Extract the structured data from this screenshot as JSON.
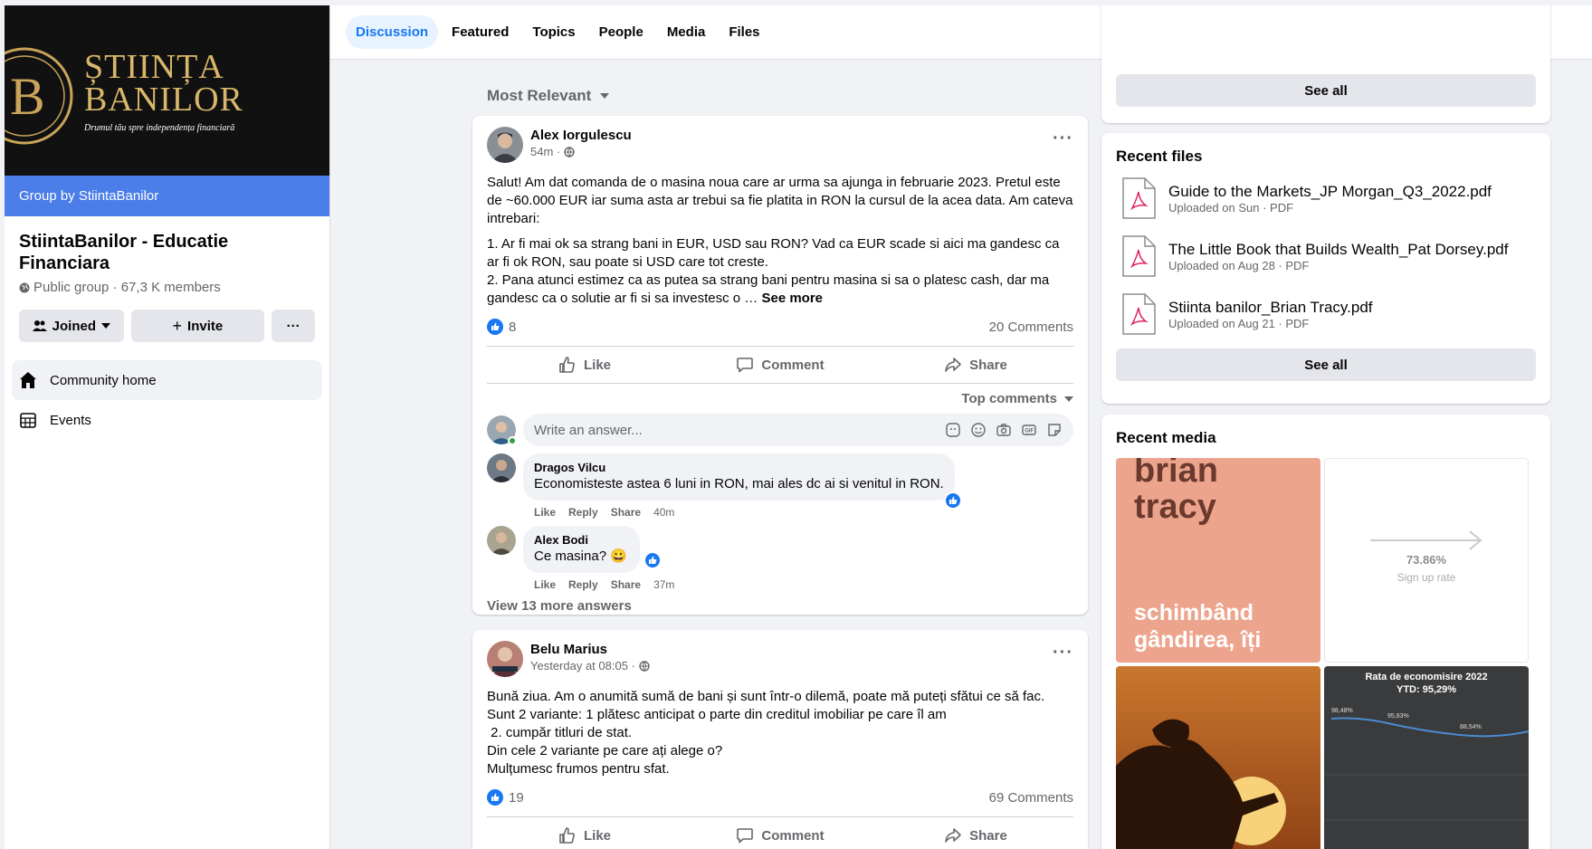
{
  "group": {
    "banner_title_1": "ȘTIINȚA",
    "banner_title_2": "BANILOR",
    "banner_tagline": "Drumul tău spre independența financiară",
    "group_by": "Group by StiintaBanilor",
    "name": "StiintaBanilor - Educatie Financiara",
    "meta": "Public group · 67,3 K members",
    "joined_label": "Joined",
    "invite_label": "Invite",
    "more_label": "···"
  },
  "nav": {
    "community_home": "Community home",
    "events": "Events"
  },
  "tabs": [
    "Discussion",
    "Featured",
    "Topics",
    "People",
    "Media",
    "Files"
  ],
  "feed": {
    "sort_label": "Most Relevant"
  },
  "posts": [
    {
      "author": "Alex Iorgulescu",
      "time": "54m ·",
      "paragraphs": [
        "Salut! Am dat comanda de o masina noua care ar urma sa ajunga in februarie 2023. Pretul este de ~60.000 EUR iar suma asta ar trebui sa fie platita in RON la cursul de la acea data. Am cateva intrebari:",
        "1. Ar fi mai ok sa strang bani in EUR, USD sau RON? Vad ca EUR scade si aici ma gandesc ca ar fi ok RON, sau poate si USD care tot creste.",
        "2. Pana atunci estimez ca as putea sa strang bani pentru masina si sa o platesc cash, dar ma gandesc ca o solutie ar fi si sa investesc o …"
      ],
      "see_more": "See more",
      "reactions": "8",
      "comments_count": "20 Comments",
      "like": "Like",
      "comment": "Comment",
      "share": "Share",
      "top_comments": "Top comments",
      "write_placeholder": "Write an answer...",
      "comments": [
        {
          "author": "Dragos Vilcu",
          "text": "Economisteste astea 6 luni in RON, mai ales dc ai si venitul in RON.",
          "like": "Like",
          "reply": "Reply",
          "share": "Share",
          "time": "40m"
        },
        {
          "author": "Alex Bodi",
          "text": "Ce masina? 😀",
          "like": "Like",
          "reply": "Reply",
          "share": "Share",
          "time": "37m"
        }
      ],
      "view_more": "View 13 more answers"
    },
    {
      "author": "Belu Marius",
      "time": "Yesterday at 08:05 ·",
      "lines": [
        "Bună ziua. Am o anumită sumă de bani și sunt într-o dilemă, poate mă puteți sfătui ce să fac.",
        "Sunt 2 variante: 1 plătesc anticipat o parte din creditul imobiliar pe care îl am",
        " 2. cumpăr titluri de stat.",
        "Din cele 2 variante pe care ați alege o?",
        "Mulțumesc frumos pentru sfat."
      ],
      "reactions": "19",
      "comments_count": "69 Comments",
      "like": "Like",
      "comment": "Comment",
      "share": "Share"
    }
  ],
  "right": {
    "see_all_top": "See all",
    "recent_files_title": "Recent files",
    "files": [
      {
        "name": "Guide to the Markets_JP Morgan_Q3_2022.pdf",
        "meta": "Uploaded on Sun · PDF"
      },
      {
        "name": "The Little Book that Builds Wealth_Pat Dorsey.pdf",
        "meta": "Uploaded on Aug 28 · PDF"
      },
      {
        "name": "Stiinta banilor_Brian Tracy.pdf",
        "meta": "Uploaded on Aug 21 · PDF"
      }
    ],
    "see_all_files": "See all",
    "recent_media_title": "Recent media",
    "media": {
      "book_title_1": "brian",
      "book_title_2": "tracy",
      "book_sub_1": "schimbând",
      "book_sub_2": "gândirea, îți",
      "rate_value": "73.86%",
      "rate_label": "Sign up rate",
      "chart_title": "Rata de economisire 2022",
      "chart_sub": "YTD: 95,29%",
      "chart_labels": [
        "98,48%",
        "95,83%",
        "88,54%"
      ]
    }
  }
}
